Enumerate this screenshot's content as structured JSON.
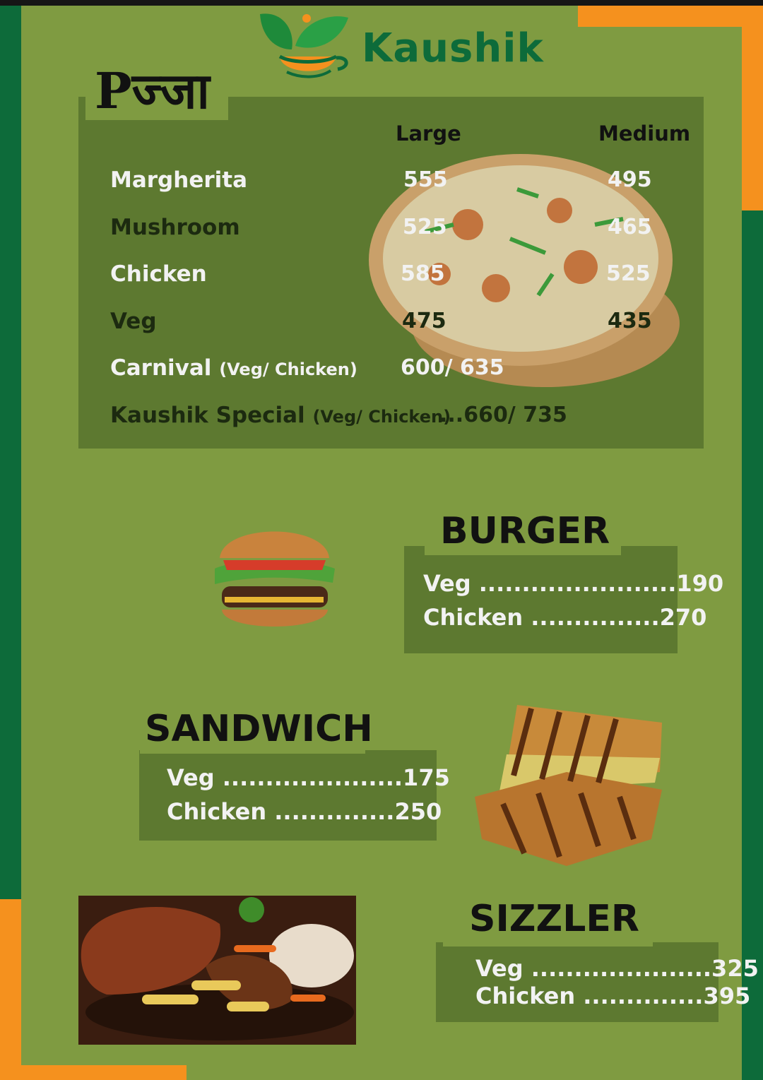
{
  "brand": {
    "name": "Kaushik"
  },
  "pizza": {
    "title": "Pज्जा",
    "col_large": "Large",
    "col_medium": "Medium",
    "items": [
      {
        "name": "Margherita",
        "large": "555",
        "medium": "495"
      },
      {
        "name": "Mushroom",
        "large": "525",
        "medium": "465"
      },
      {
        "name": "Chicken",
        "large": "585",
        "medium": "525"
      },
      {
        "name": "Veg",
        "large": "475",
        "medium": "435"
      }
    ],
    "carnival": {
      "name": "Carnival",
      "sub": "(Veg/ Chicken)",
      "price": "600/ 635"
    },
    "special": {
      "name": "Kaushik Special",
      "sub": "(Veg/ Chicken)",
      "price": "...660/ 735"
    }
  },
  "burger": {
    "title": "BURGER",
    "lines": [
      "Veg .......................190",
      "Chicken ...............270"
    ]
  },
  "sandwich": {
    "title": "SANDWICH",
    "lines": [
      "Veg .....................175",
      "Chicken ..............250"
    ]
  },
  "sizzler": {
    "title": "SIZZLER",
    "lines": [
      "Veg .....................325",
      "Chicken ..............395"
    ]
  },
  "colors": {
    "background": "#7f9b41",
    "panel": "#5d7930",
    "green_stripe": "#0d6b3a",
    "orange_stripe": "#f5911e"
  }
}
